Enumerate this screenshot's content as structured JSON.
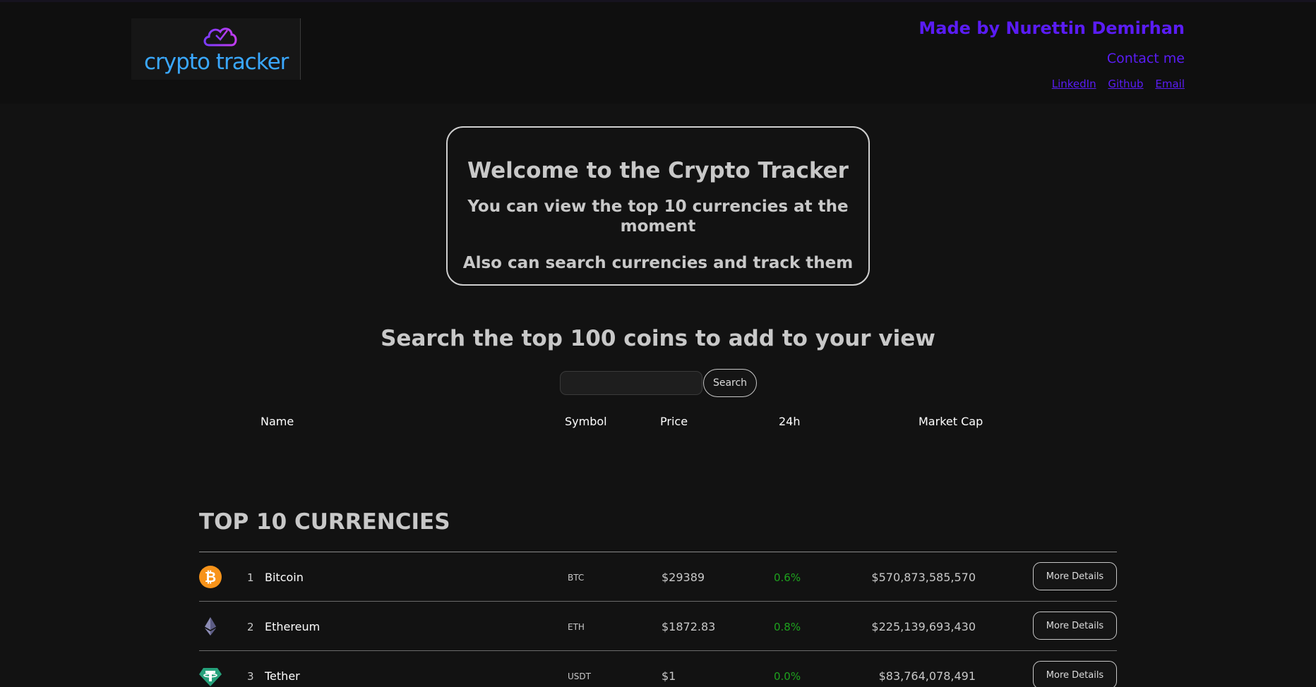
{
  "header": {
    "logo_text": "crypto tracker",
    "made_by": "Made by Nurettin Demirhan",
    "contact": "Contact me",
    "links": [
      "LinkedIn",
      "Github",
      "Email"
    ]
  },
  "welcome": {
    "title": "Welcome to the Crypto Tracker",
    "line1": "You can view the top 10 currencies at the moment",
    "line2": "Also can search currencies and track them"
  },
  "search": {
    "title": "Search the top 100 coins to add to your view",
    "input_value": "",
    "button_label": "Search"
  },
  "columns": [
    "Name",
    "Symbol",
    "Price",
    "24h",
    "Market Cap"
  ],
  "top10": {
    "title": "TOP 10 CURRENCIES",
    "button_label": "More Details",
    "coins": [
      {
        "rank": "1",
        "name": "Bitcoin",
        "symbol": "BTC",
        "price": "$29389",
        "change": "0.6%",
        "market_cap": "$570,873,585,570",
        "icon": "bitcoin-icon"
      },
      {
        "rank": "2",
        "name": "Ethereum",
        "symbol": "ETH",
        "price": "$1872.83",
        "change": "0.8%",
        "market_cap": "$225,139,693,430",
        "icon": "ethereum-icon"
      },
      {
        "rank": "3",
        "name": "Tether",
        "symbol": "USDT",
        "price": "$1",
        "change": "0.0%",
        "market_cap": "$83,764,078,491",
        "icon": "tether-icon"
      }
    ]
  },
  "colors": {
    "accent": "#5a1cf5",
    "positive": "#1ea21e",
    "background": "#121212",
    "logo_text": "#3aa8ff"
  }
}
